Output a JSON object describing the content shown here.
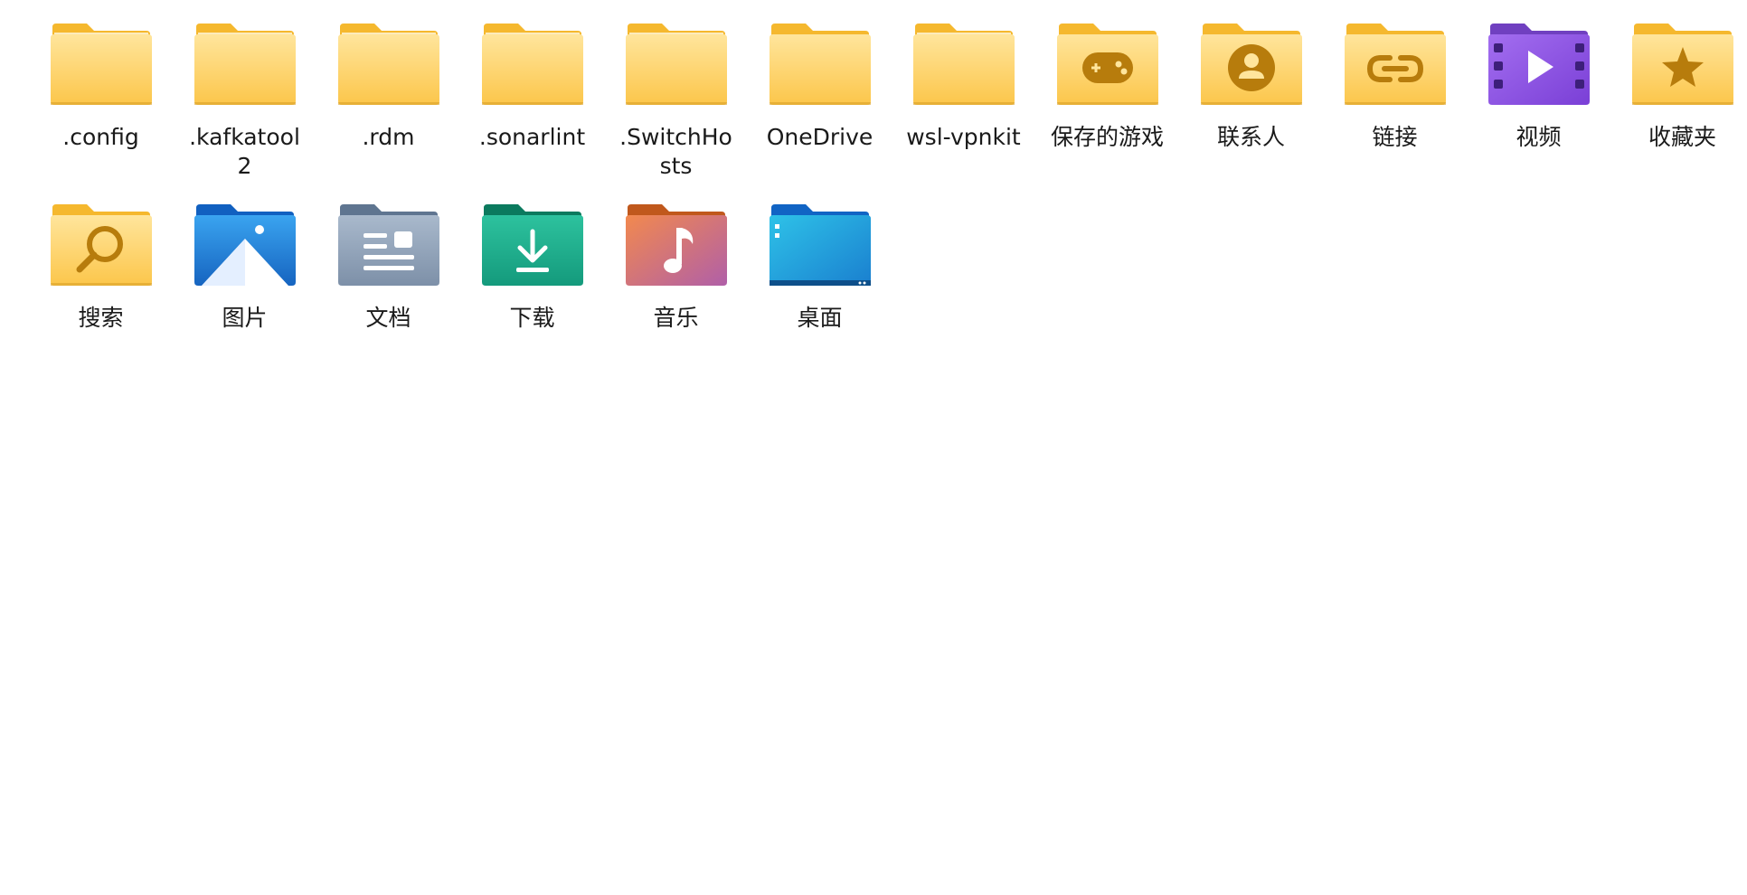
{
  "items": [
    {
      "label": ".config",
      "icon": "folder-icon"
    },
    {
      "label": ".kafkatool2",
      "icon": "folder-icon"
    },
    {
      "label": ".rdm",
      "icon": "folder-icon"
    },
    {
      "label": ".sonarlint",
      "icon": "folder-icon"
    },
    {
      "label": ".SwitchHosts",
      "icon": "folder-icon"
    },
    {
      "label": "OneDrive",
      "icon": "onedrive-folder-icon"
    },
    {
      "label": "wsl-vpnkit",
      "icon": "folder-icon"
    },
    {
      "label": "保存的游戏",
      "icon": "saved-games-folder-icon"
    },
    {
      "label": "联系人",
      "icon": "contacts-folder-icon"
    },
    {
      "label": "链接",
      "icon": "links-folder-icon"
    },
    {
      "label": "视频",
      "icon": "videos-folder-icon"
    },
    {
      "label": "收藏夹",
      "icon": "favorites-folder-icon"
    },
    {
      "label": "搜索",
      "icon": "searches-folder-icon"
    },
    {
      "label": "图片",
      "icon": "pictures-folder-icon"
    },
    {
      "label": "文档",
      "icon": "documents-folder-icon"
    },
    {
      "label": "下载",
      "icon": "downloads-folder-icon"
    },
    {
      "label": "音乐",
      "icon": "music-folder-icon"
    },
    {
      "label": "桌面",
      "icon": "desktop-folder-icon"
    }
  ],
  "colors": {
    "folder_back": "#f5b82e",
    "folder_front_top": "#ffe598",
    "folder_front_bottom": "#fcc84a",
    "glyph_yellow": "#b77c0c",
    "videos": "#8a4fe0",
    "pictures": "#1e83d9",
    "documents": "#8fa3ba",
    "downloads": "#1aa68a",
    "music": "#e07a5a",
    "desktop": "#1ba1d6",
    "text": "#1a1a1a"
  }
}
